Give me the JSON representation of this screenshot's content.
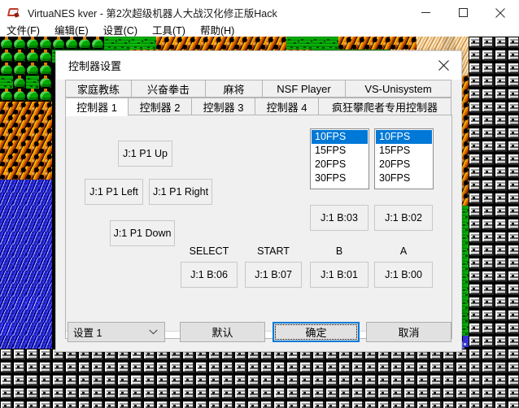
{
  "window": {
    "title": "VirtuaNES kver - 第2次超级机器人大战汉化修正版Hack",
    "icon": "virtuanes-app-icon",
    "controls": {
      "minimize": "minimize-icon",
      "maximize": "maximize-icon",
      "close": "close-icon"
    }
  },
  "menubar": {
    "items": [
      {
        "label": "文件(F)"
      },
      {
        "label": "编辑(E)"
      },
      {
        "label": "设置(C)"
      },
      {
        "label": "工具(T)"
      },
      {
        "label": "帮助(H)"
      }
    ]
  },
  "dialog": {
    "title": "控制器设置",
    "close_icon": "close-icon",
    "tabs_row1": [
      {
        "label": "家庭教练",
        "selected": false
      },
      {
        "label": "兴奋拳击",
        "selected": false
      },
      {
        "label": "麻将",
        "selected": false
      },
      {
        "label": "NSF Player",
        "selected": false
      },
      {
        "label": "VS-Unisystem",
        "selected": false
      }
    ],
    "tabs_row2": [
      {
        "label": "控制器 1",
        "selected": true
      },
      {
        "label": "控制器 2",
        "selected": false
      },
      {
        "label": "控制器 3",
        "selected": false
      },
      {
        "label": "控制器 4",
        "selected": false
      },
      {
        "label": "疯狂攀爬者专用控制器",
        "selected": false
      }
    ],
    "dpad": {
      "up": "J:1 P1 Up",
      "left": "J:1 P1 Left",
      "right": "J:1 P1 Right",
      "down": "J:1 P1 Down"
    },
    "labels": {
      "select": "SELECT",
      "start": "START",
      "b": "B",
      "a": "A"
    },
    "buttons": {
      "select": "J:1 B:06",
      "start": "J:1 B:07",
      "turbo_b": "J:1 B:03",
      "turbo_a": "J:1 B:02",
      "b": "J:1 B:01",
      "a": "J:1 B:00"
    },
    "turbo_lists": [
      {
        "name": "turbo-b-rate",
        "options": [
          "10FPS",
          "15FPS",
          "20FPS",
          "30FPS"
        ],
        "selected": "10FPS"
      },
      {
        "name": "turbo-a-rate",
        "options": [
          "10FPS",
          "15FPS",
          "20FPS",
          "30FPS"
        ],
        "selected": "10FPS"
      }
    ],
    "footer": {
      "preset": "设置 1",
      "preset_arrow": "chevron-down-icon",
      "default_label": "默认",
      "ok_label": "确定",
      "cancel_label": "取消"
    }
  },
  "theme": {
    "accent": "#0078d7",
    "dialog_bg": "#f0f0f0",
    "button_bg": "#e1e1e1",
    "border": "#adadad",
    "list_bg": "#ffffff"
  }
}
